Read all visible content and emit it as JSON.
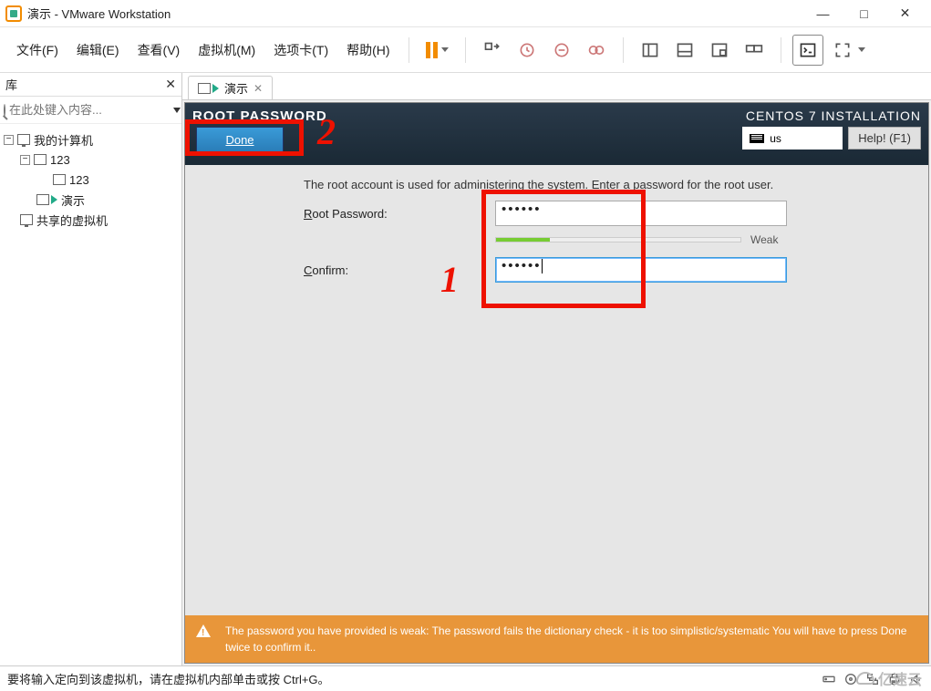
{
  "window": {
    "title": "演示 - VMware Workstation",
    "min": "—",
    "max": "□",
    "close": "✕"
  },
  "menu": {
    "file": "文件(F)",
    "edit": "编辑(E)",
    "view": "查看(V)",
    "vm": "虚拟机(M)",
    "tabs": "选项卡(T)",
    "help": "帮助(H)"
  },
  "sidebar": {
    "title": "库",
    "search_placeholder": "在此处键入内容...",
    "tree": {
      "root": "我的计算机",
      "item1": "123",
      "item1a": "123",
      "item2": "演示",
      "shared": "共享的虚拟机"
    }
  },
  "tab": {
    "label": "演示"
  },
  "centos": {
    "header": "ROOT PASSWORD",
    "done": "Done",
    "install": "CENTOS 7 INSTALLATION",
    "kbd": "us",
    "help": "Help! (F1)",
    "info": "The root account is used for administering the system.  Enter a password for the root user.",
    "root_label_pre": "R",
    "root_label": "oot Password:",
    "confirm_label_pre": "C",
    "confirm_label": "onfirm:",
    "pw1": "••••••",
    "pw2": "••••••",
    "strength": "Weak",
    "warning": "The password you have provided is weak: The password fails the dictionary check - it is too simplistic/systematic You will have to press Done twice to confirm it.."
  },
  "annotations": {
    "one": "1",
    "two": "2"
  },
  "status": {
    "text": "要将输入定向到该虚拟机，请在虚拟机内部单击或按 Ctrl+G。",
    "watermark": "亿速云"
  }
}
